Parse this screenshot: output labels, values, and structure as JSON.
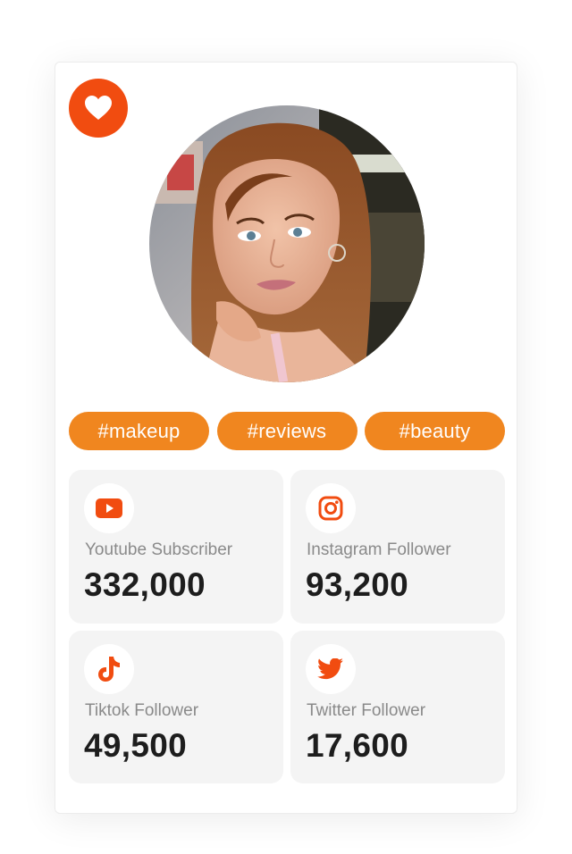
{
  "colors": {
    "accent": "#f14c10",
    "tag_bg": "#f0861f",
    "stat_bg": "#f4f4f4",
    "label": "#8a8a8a",
    "value": "#1d1d1d"
  },
  "favorite": {
    "icon": "heart-icon"
  },
  "profile": {
    "photo": "profile-photo"
  },
  "tags": [
    "#makeup",
    "#reviews",
    "#beauty"
  ],
  "stats": [
    {
      "icon": "youtube-icon",
      "label": "Youtube Subscriber",
      "value": "332,000"
    },
    {
      "icon": "instagram-icon",
      "label": "Instagram Follower",
      "value": "93,200"
    },
    {
      "icon": "tiktok-icon",
      "label": "Tiktok Follower",
      "value": "49,500"
    },
    {
      "icon": "twitter-icon",
      "label": "Twitter Follower",
      "value": "17,600"
    }
  ]
}
